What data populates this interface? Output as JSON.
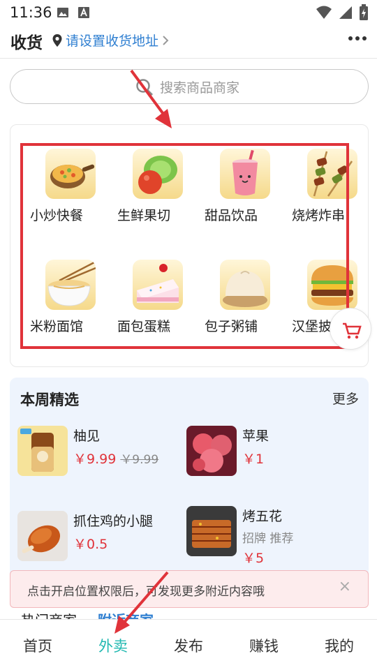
{
  "status_bar": {
    "time": "11:36",
    "icons": [
      "image-icon",
      "a-text-icon",
      "wifi-icon",
      "signal-icon",
      "battery-charging-icon"
    ]
  },
  "header": {
    "title": "收货",
    "address_label": "请设置收货地址",
    "address_icon": "location-pin-icon",
    "more_icon": "more-dots-icon"
  },
  "search": {
    "placeholder": "搜索商品商家"
  },
  "categories": [
    {
      "label": "小炒快餐",
      "icon": "stir-fry-pan-icon"
    },
    {
      "label": "生鲜果切",
      "icon": "fresh-fruit-icon"
    },
    {
      "label": "甜品饮品",
      "icon": "drink-cup-icon"
    },
    {
      "label": "烧烤炸串",
      "icon": "skewers-icon"
    },
    {
      "label": "米粉面馆",
      "icon": "noodle-bowl-icon"
    },
    {
      "label": "面包蛋糕",
      "icon": "cake-icon"
    },
    {
      "label": "包子粥铺",
      "icon": "steamed-bun-icon"
    },
    {
      "label": "汉堡披",
      "icon": "burger-icon"
    }
  ],
  "weekly": {
    "title": "本周精选",
    "more": "更多",
    "products": [
      {
        "name": "柚见",
        "price": "￥9.99",
        "old_price": "￥9.99"
      },
      {
        "name": "苹果",
        "price": "￥1"
      },
      {
        "name": "抓住鸡的小腿",
        "price": "￥0.5"
      },
      {
        "name": "烤五花",
        "tags": "招牌 推荐",
        "price": "￥5"
      }
    ]
  },
  "banner": {
    "text": "点击开启位置权限后，可发现更多附近内容哦",
    "close": "×"
  },
  "hot": {
    "label": "热门商家",
    "link": "附近商家"
  },
  "tabbar": {
    "tabs": [
      {
        "label": "首页",
        "active": false
      },
      {
        "label": "外卖",
        "active": true
      },
      {
        "label": "发布",
        "active": false
      },
      {
        "label": "赚钱",
        "active": false
      },
      {
        "label": "我的",
        "active": false
      }
    ]
  },
  "colors": {
    "accent_teal": "#20b8b0",
    "link_blue": "#2f7fd1",
    "price_red": "#e0333a",
    "annotation_red": "#e0333a"
  }
}
